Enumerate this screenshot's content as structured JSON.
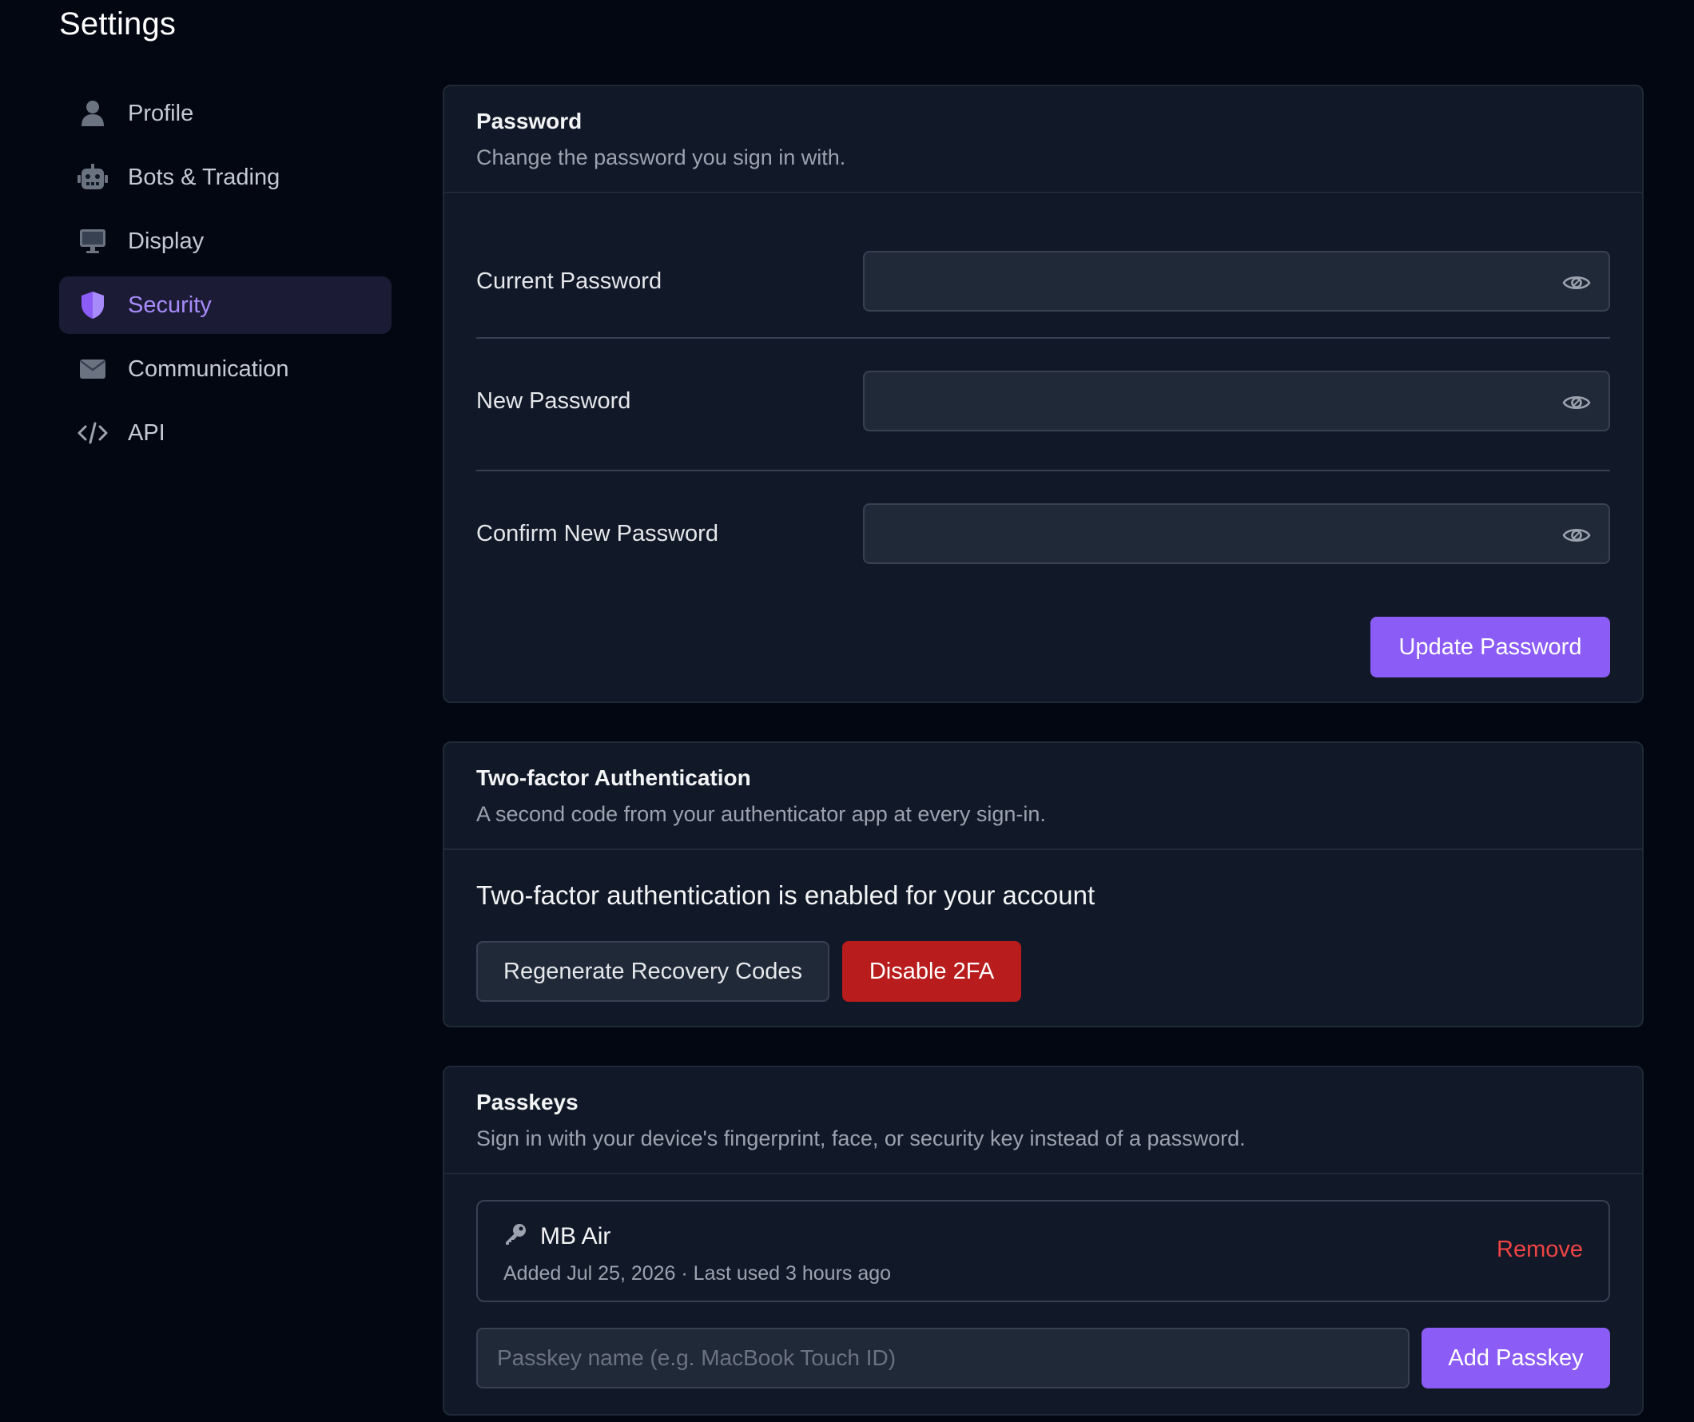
{
  "page": {
    "title": "Settings"
  },
  "sidebar": {
    "items": [
      {
        "label": "Profile",
        "icon": "user-icon",
        "active": false
      },
      {
        "label": "Bots & Trading",
        "icon": "robot-icon",
        "active": false
      },
      {
        "label": "Display",
        "icon": "monitor-icon",
        "active": false
      },
      {
        "label": "Security",
        "icon": "shield-icon",
        "active": true
      },
      {
        "label": "Communication",
        "icon": "envelope-icon",
        "active": false
      },
      {
        "label": "API",
        "icon": "code-icon",
        "active": false
      }
    ]
  },
  "password": {
    "title": "Password",
    "subtitle": "Change the password you sign in with.",
    "fields": {
      "current": {
        "label": "Current Password",
        "value": ""
      },
      "new": {
        "label": "New Password",
        "value": ""
      },
      "confirm": {
        "label": "Confirm New Password",
        "value": ""
      }
    },
    "update_label": "Update Password"
  },
  "two_factor": {
    "title": "Two-factor Authentication",
    "subtitle": "A second code from your authenticator app at every sign-in.",
    "status": "Two-factor authentication is enabled for your account",
    "regenerate_label": "Regenerate Recovery Codes",
    "disable_label": "Disable 2FA"
  },
  "passkeys": {
    "title": "Passkeys",
    "subtitle": "Sign in with your device's fingerprint, face, or security key instead of a password.",
    "items": [
      {
        "name": "MB Air",
        "meta": "Added Jul 25, 2026 · Last used 3 hours ago",
        "remove_label": "Remove"
      }
    ],
    "name_input": {
      "placeholder": "Passkey name (e.g. MacBook Touch ID)",
      "value": ""
    },
    "add_label": "Add Passkey"
  },
  "colors": {
    "background": "#030712",
    "card": "#111827",
    "accent": "#8b5cf6",
    "active_nav_text": "#a78bfa",
    "danger": "#b91c1c",
    "remove": "#ef4444"
  }
}
